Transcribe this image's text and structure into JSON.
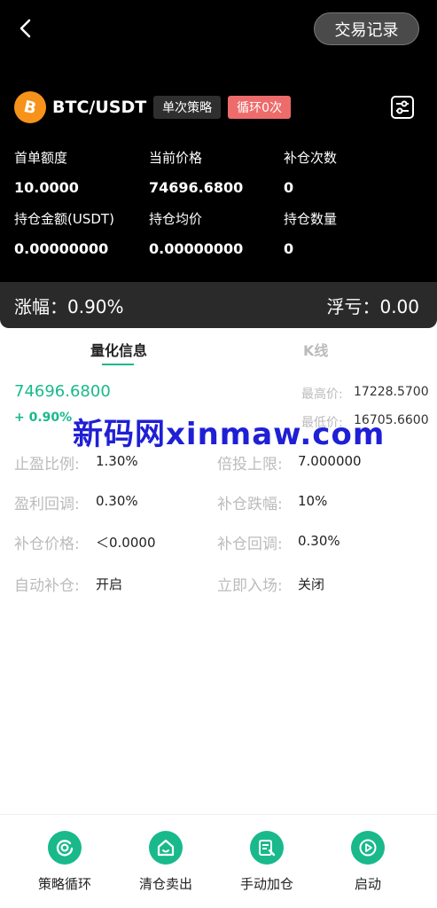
{
  "header": {
    "record_button": "交易记录",
    "pair": "BTC/USDT",
    "strategy_badge": "单次策略",
    "cycle_badge": "循环0次"
  },
  "stats": [
    {
      "label": "首单额度",
      "value": "10.0000"
    },
    {
      "label": "当前价格",
      "value": "74696.6800"
    },
    {
      "label": "补仓次数",
      "value": "0"
    },
    {
      "label": "持仓金额(USDT)",
      "value": "0.00000000"
    },
    {
      "label": "持仓均价",
      "value": "0.00000000"
    },
    {
      "label": "持仓数量",
      "value": "0"
    }
  ],
  "change_bar": {
    "change": "涨幅：0.90%",
    "float_loss": "浮亏：0.00"
  },
  "tabs": [
    "量化信息",
    "K线"
  ],
  "quote": {
    "price": "74696.6800",
    "pct": "+ 0.90%",
    "high_label": "最高价:",
    "high_value": "17228.5700",
    "low_label": "最低价:",
    "low_value": "16705.6600"
  },
  "watermark": "新码网xinmaw.com",
  "params": [
    {
      "label": "止盈比例:",
      "value": "1.30%"
    },
    {
      "label": "倍投上限:",
      "value": "7.000000"
    },
    {
      "label": "盈利回调:",
      "value": "0.30%"
    },
    {
      "label": "补仓跌幅:",
      "value": "10%"
    },
    {
      "label": "补仓价格:",
      "value": "＜0.0000"
    },
    {
      "label": "补仓回调:",
      "value": "0.30%"
    },
    {
      "label": "自动补仓:",
      "value": "开启"
    },
    {
      "label": "立即入场:",
      "value": "关闭"
    }
  ],
  "bottom_nav": [
    {
      "label": "策略循环",
      "icon": "cycle-icon"
    },
    {
      "label": "清仓卖出",
      "icon": "house-sell-icon"
    },
    {
      "label": "手动加仓",
      "icon": "manual-add-icon"
    },
    {
      "label": "启动",
      "icon": "play-icon"
    }
  ],
  "colors": {
    "accent": "#19b98b",
    "cycle_badge": "#ee6b6b",
    "bitcoin": "#f7931a"
  }
}
